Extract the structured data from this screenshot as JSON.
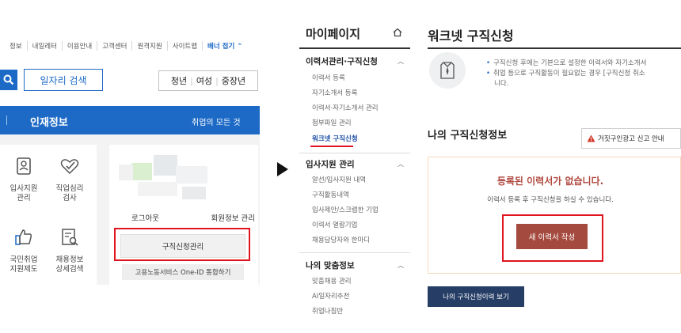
{
  "left_panel": {
    "top_nav": [
      "정보",
      "내일레터",
      "이용안내",
      "고객센터",
      "원격지원",
      "사이트맵"
    ],
    "banner_toggle": "배너 접기 ⌃",
    "job_search_label": "일자리 검색",
    "filters": [
      "청년",
      "여성",
      "중장년"
    ],
    "section_title": "인재정보",
    "section_sub": "취업의 모든 것",
    "tiles": [
      {
        "label_1": "입사지원",
        "label_2": "관리",
        "icon": "id-card-icon"
      },
      {
        "label_1": "직업심리",
        "label_2": "검사",
        "icon": "heart-check-icon"
      },
      {
        "label_1": "국민취업",
        "label_2": "지원제도",
        "icon": "thumbs-up-icon"
      },
      {
        "label_1": "채용정보",
        "label_2": "상세검색",
        "icon": "document-search-icon"
      }
    ],
    "logout_label": "로그아웃",
    "member_info_label": "회원정보 관리",
    "apply_management_label": "구직신청관리",
    "oneid_label": "고용노동서비스 One-ID 통합하기"
  },
  "sidebar": {
    "title": "마이페이지",
    "groups": [
      {
        "title": "이력서관리·구직신청",
        "items": [
          {
            "label": "이력서 등록"
          },
          {
            "label": "자기소개서 등록"
          },
          {
            "label": "이력서·자기소개서 관리"
          },
          {
            "label": "첨부파일 관리"
          },
          {
            "label": "워크넷 구직신청",
            "active": true
          }
        ]
      },
      {
        "title": "입사지원 관리",
        "items": [
          {
            "label": "알선/입사지원 내역"
          },
          {
            "label": "구직활동내역"
          },
          {
            "label": "입사제안/스크랩한 기업"
          },
          {
            "label": "이력서 열람기업"
          },
          {
            "label": "채용담당자와 한마디"
          }
        ]
      },
      {
        "title": "나의 맞춤정보",
        "items": [
          {
            "label": "맞춤채용 관리"
          },
          {
            "label": "AI일자리추천"
          },
          {
            "label": "취업나침반"
          }
        ]
      }
    ]
  },
  "main": {
    "title": "워크넷 구직신청",
    "notes": [
      "구직신청 후에는 기본으로 설정한 이력서와 자기소개서",
      "취업 등으로 구직활동이 필요없는 경우 [구직신청 취소",
      "니다."
    ],
    "status_title": "나의 구직신청정보",
    "report_button": "거짓구인광고 신고 안내",
    "empty_title": "등록된 이력서가 없습니다.",
    "empty_sub": "이력서 등록 후 구직신청을 하실 수 있습니다.",
    "new_resume_button": "새 이력서 작성",
    "history_button": "나의 구직신청이력 보기"
  },
  "colors": {
    "primary_blue": "#1d6ac6",
    "highlight_red": "#e0141e",
    "button_brown": "#a54a3f",
    "navy": "#263e66"
  }
}
